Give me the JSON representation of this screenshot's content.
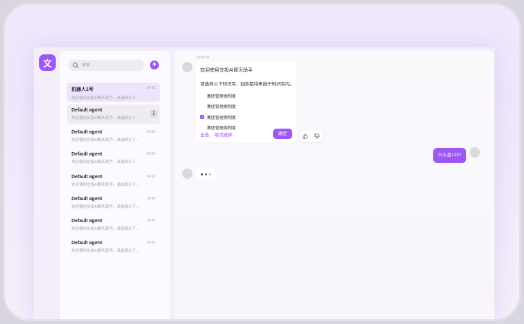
{
  "app": {
    "logo_char": "文",
    "accent": "#9d57f3"
  },
  "sidebar": {
    "search_placeholder": "搜索",
    "add_label": "+",
    "agents": [
      {
        "name": "机器人1号",
        "preview": "欢迎使用交投AI聊天助手。请选择以下...",
        "time": "14:10",
        "state": "selected"
      },
      {
        "name": "Default agent",
        "preview": "欢迎使用交投AI聊天助手。请选择以下...",
        "time": "",
        "state": "hover",
        "more": "⋮"
      },
      {
        "name": "Default agent",
        "preview": "欢迎使用交投AI聊天助手。请选择以下...",
        "time": "14:10",
        "state": ""
      },
      {
        "name": "Default agent",
        "preview": "欢迎使用交投AI聊天助手。请选择以下...",
        "time": "14:10",
        "state": ""
      },
      {
        "name": "Default agent",
        "preview": "欢迎使用交投AI聊天助手。请选择以下...",
        "time": "14:10",
        "state": ""
      },
      {
        "name": "Default agent",
        "preview": "欢迎使用交投AI聊天助手。请选择以下...",
        "time": "14:10",
        "state": ""
      },
      {
        "name": "Default agent",
        "preview": "欢迎使用交投AI聊天助手。请选择以下...",
        "time": "14:10",
        "state": ""
      },
      {
        "name": "Default agent",
        "preview": "欢迎使用交投AI聊天助手。请选择以下...",
        "time": "14:10",
        "state": ""
      }
    ]
  },
  "chat": {
    "timestamp": "15:45:15",
    "welcome": "欢迎使用交投AI聊天助手",
    "instruction": "请选择以下知识库，回答都将来自于知识库内。",
    "options": [
      {
        "label": "集团管理类制度",
        "checked": false
      },
      {
        "label": "集团管理类制度",
        "checked": false
      },
      {
        "label": "集团管理类制度",
        "checked": true
      },
      {
        "label": "集团管理类制度",
        "checked": false
      }
    ],
    "select_all": "全选",
    "cancel_select": "取消选择",
    "confirm": "确定",
    "user_message": "什么是123?"
  }
}
